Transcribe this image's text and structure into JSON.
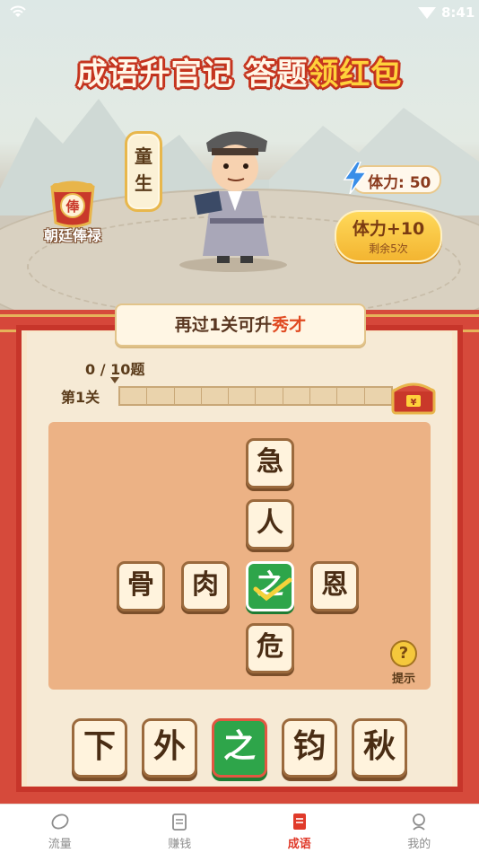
{
  "status": {
    "time": "8:41"
  },
  "header": {
    "title_part1": "成语升官记 答题",
    "title_highlight": "领红包"
  },
  "salary": {
    "badge_char": "俸",
    "label": "朝廷俸禄"
  },
  "rank": {
    "title_chars": [
      "童",
      "生"
    ]
  },
  "energy": {
    "label": "体力: 50",
    "bonus_label": "体力+10",
    "bonus_remaining": "剩余5次"
  },
  "banner": {
    "prefix": "再过1关可升",
    "highlight": "秀才"
  },
  "progress": {
    "count": "0 / 10题",
    "level": "第1关",
    "value": 0,
    "total": 10
  },
  "chest_icon": {
    "char": "¥"
  },
  "puzzle": {
    "vertical": [
      "急",
      "人"
    ],
    "center": "之",
    "below": "危",
    "left": [
      "骨",
      "肉"
    ],
    "right": "恩"
  },
  "hint": {
    "label": "提示",
    "icon": "?"
  },
  "options": [
    "下",
    "外",
    "之",
    "钧",
    "秋"
  ],
  "selected_option": 2,
  "nav": {
    "items": [
      {
        "label": "流量",
        "icon": "leaf-icon"
      },
      {
        "label": "赚钱",
        "icon": "document-icon"
      },
      {
        "label": "成语",
        "icon": "book-icon"
      },
      {
        "label": "我的",
        "icon": "person-icon"
      }
    ],
    "active_index": 2
  },
  "colors": {
    "accent": "#e03a2a",
    "tile_green": "#2ea54a",
    "board_red": "#d64a3b"
  }
}
